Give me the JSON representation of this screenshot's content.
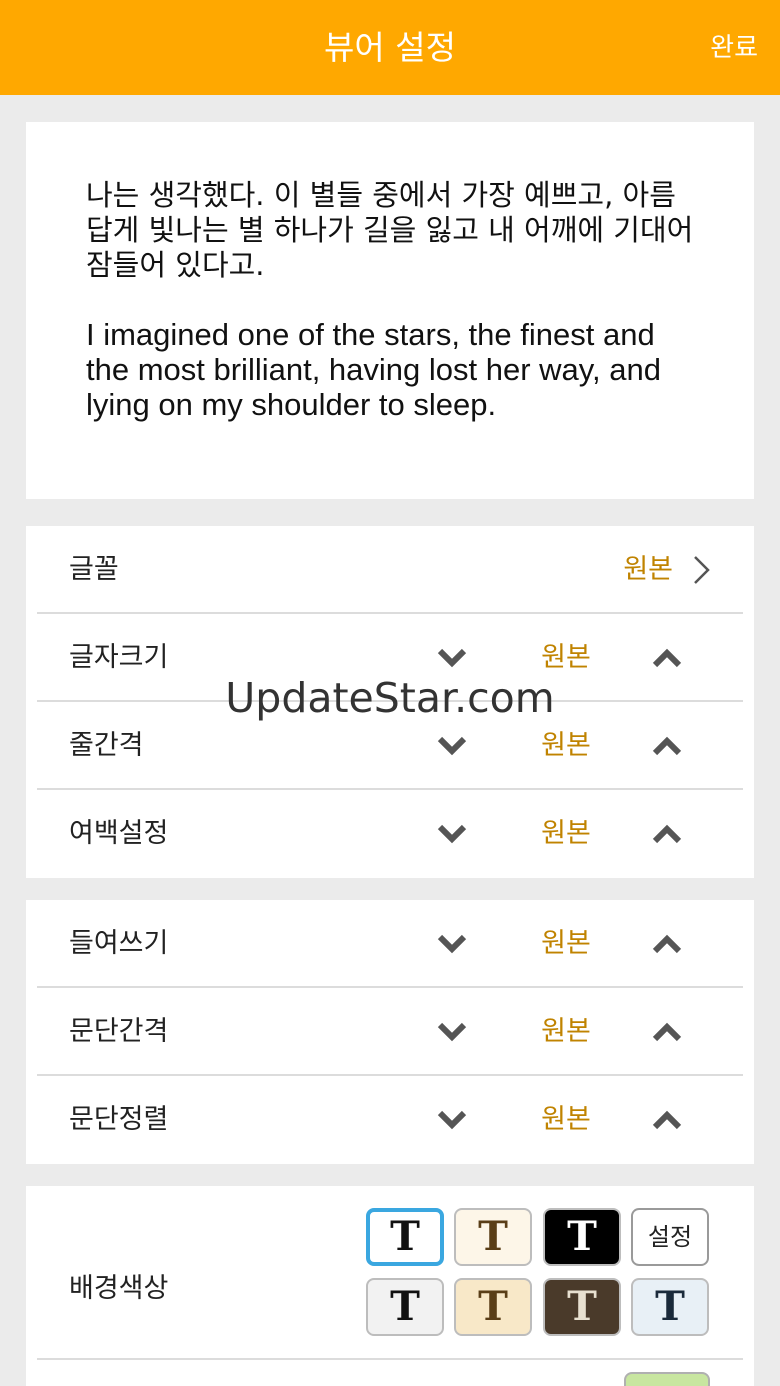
{
  "header": {
    "title": "뷰어 설정",
    "done_label": "완료"
  },
  "preview": {
    "korean_text": "나는 생각했다. 이 별들 중에서 가장 예쁘고, 아름답게 빛나는 별 하나가 길을 잃고 내 어깨에 기대어 잠들어 있다고.",
    "english_text": "I imagined one of the stars, the finest and the most brilliant, having lost her way, and lying on my shoulder to sleep."
  },
  "font_row": {
    "label": "글꼴",
    "value": "원본"
  },
  "group1": [
    {
      "label": "글자크기",
      "value": "원본"
    },
    {
      "label": "줄간격",
      "value": "원본"
    },
    {
      "label": "여백설정",
      "value": "원본"
    }
  ],
  "group2": [
    {
      "label": "들여쓰기",
      "value": "원본"
    },
    {
      "label": "문단간격",
      "value": "원본"
    },
    {
      "label": "문단정렬",
      "value": "원본"
    }
  ],
  "background": {
    "label": "배경색상",
    "swatch_glyph": "T",
    "custom_label": "설정",
    "swatches": [
      {
        "bg": "#ffffff",
        "fg": "#111111"
      },
      {
        "bg": "#fdf6e8",
        "fg": "#5a3e17"
      },
      {
        "bg": "#000000",
        "fg": "#ffffff"
      },
      {
        "bg": "#f2f2f2",
        "fg": "#111111"
      },
      {
        "bg": "#f8e8c8",
        "fg": "#5a3e17"
      },
      {
        "bg": "#4a3a2a",
        "fg": "#e8e0d0"
      },
      {
        "bg": "#e8f0f6",
        "fg": "#1a2a3a"
      }
    ]
  },
  "colors": {
    "accent": "#ffa800",
    "value_text": "#c08300",
    "selected_border": "#3aa7e0"
  },
  "watermark": "UpdateStar.com"
}
